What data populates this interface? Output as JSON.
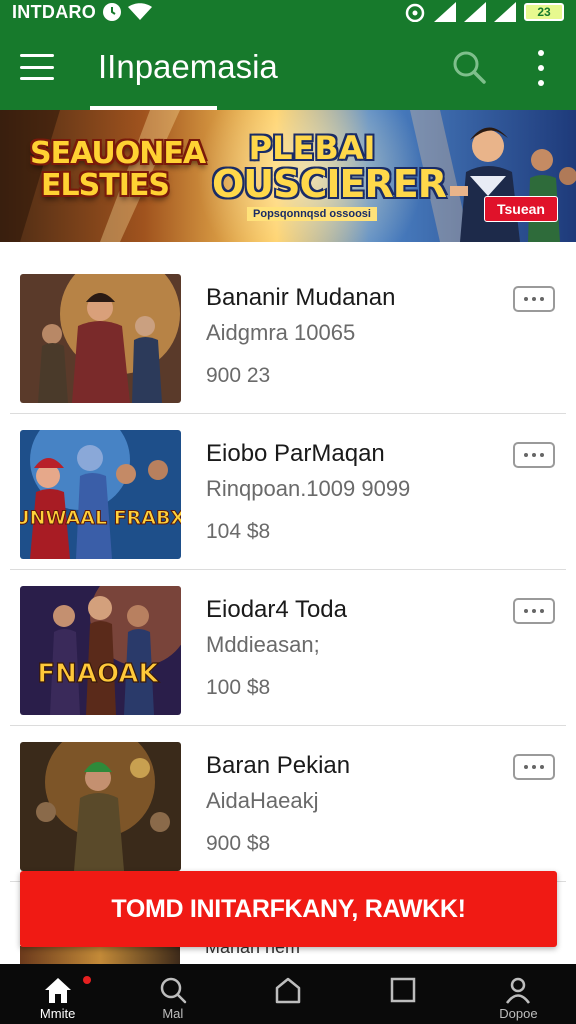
{
  "status_bar": {
    "left_text": "INTDARO",
    "battery_text": "23"
  },
  "app_bar": {
    "title": "IInpaemasia",
    "search_icon": "search-icon",
    "more_icon": "more-vertical-icon"
  },
  "banner": {
    "left_logo": "SEAUONEA ELSTIES",
    "center_line1": "PLEBAI",
    "center_line2": "OUSCIERER",
    "center_tagline": "Popsqonnqsd ossoosi",
    "cta": "Tsuean"
  },
  "items": [
    {
      "title": "Bananir Mudanan",
      "subtitle": "Aidgmra 10065",
      "price": "900 23"
    },
    {
      "title": "Eiobo ParMaqan",
      "subtitle": "Rinqpoan.1009 9099",
      "price": "104 $8"
    },
    {
      "title": "Eiodar4 Toda",
      "subtitle": "Mddieasan;",
      "price": "100 $8"
    },
    {
      "title": "Baran Pekian",
      "subtitle": "AidaHaeakj",
      "price": "900 $8"
    }
  ],
  "thumb_texts": {
    "item2": "DAUNWAAL FRABXAN",
    "item3": "FNAOAK"
  },
  "toast": {
    "text": "TOMD INITARFKANY, RAWKK!"
  },
  "partial_item": {
    "text": "Manan nem"
  },
  "bottom_nav": [
    {
      "label": "Mmite",
      "icon": "home-icon",
      "active": true
    },
    {
      "label": "Mal",
      "icon": "search-icon",
      "active": false
    },
    {
      "label": "",
      "icon": "house-outline-icon",
      "active": false
    },
    {
      "label": "",
      "icon": "square-icon",
      "active": false
    },
    {
      "label": "Dopoe",
      "icon": "profile-icon",
      "active": false
    }
  ],
  "colors": {
    "primary": "#177a2c",
    "toast": "#f01a14",
    "nav_bg": "#0a0a0a"
  }
}
